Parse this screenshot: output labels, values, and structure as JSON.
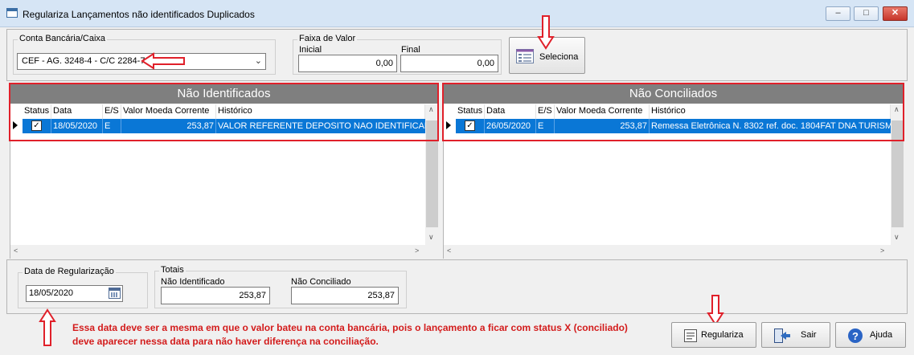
{
  "window": {
    "title": "Regulariza Lançamentos não identificados  Duplicados",
    "min_icon": "minimize-icon",
    "max_icon": "maximize-icon",
    "close_icon": "close-icon"
  },
  "filters": {
    "account_group_label": "Conta Bancária/Caixa",
    "account_value": "CEF - AG. 3248-4 - C/C 2284-7",
    "range_group_label": "Faixa de Valor",
    "initial_label": "Inicial",
    "initial_value": "0,00",
    "final_label": "Final",
    "final_value": "0,00",
    "select_button_label": "Seleciona"
  },
  "grid_left": {
    "title": "Não Identificados",
    "columns": [
      "Status",
      "Data",
      "E/S",
      "Valor Moeda Corrente",
      "Histórico"
    ],
    "rows": [
      {
        "checked": true,
        "date": "18/05/2020",
        "es": "E",
        "value": "253,87",
        "history": "VALOR REFERENTE DEPOSITO NAO IDENTIFICADO"
      }
    ]
  },
  "grid_right": {
    "title": "Não Conciliados",
    "columns": [
      "Status",
      "Data",
      "E/S",
      "Valor Moeda Corrente",
      "Histórico"
    ],
    "rows": [
      {
        "checked": true,
        "date": "26/05/2020",
        "es": "E",
        "value": "253,87",
        "history": "Remessa Eletrônica N. 8302 ref. doc. 1804FAT  DNA TURISM"
      }
    ]
  },
  "bottom": {
    "date_group_label": "Data de Regularização",
    "date_value": "18/05/2020",
    "totals_group_label": "Totais",
    "not_identified_label": "Não Identificado",
    "not_identified_value": "253,87",
    "not_reconciled_label": "Não Conciliado",
    "not_reconciled_value": "253,87"
  },
  "annotation": {
    "line1": "Essa data deve ser a mesma em que o valor bateu na conta bancária, pois o lançamento a ficar com status X (conciliado)",
    "line2": "deve aparecer nessa data para não haver diferença na conciliação.",
    "color": "#d31c1c"
  },
  "actions": {
    "regulariza_label": "Regulariza",
    "sair_label": "Sair",
    "ajuda_label": "Ajuda"
  },
  "colors": {
    "selection": "#0a77d6",
    "grid_header": "#7f7f7f",
    "highlight_frame": "#e0202a"
  }
}
